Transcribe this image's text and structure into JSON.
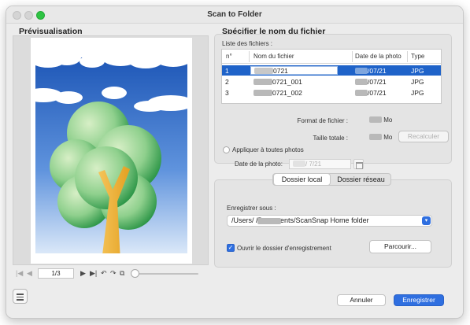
{
  "window": {
    "title": "Scan to Folder"
  },
  "preview": {
    "section_title": "Prévisualisation",
    "page_indicator": "1/3"
  },
  "file_name": {
    "section_title": "Spécifier le nom du fichier",
    "list_label": "Liste des fichiers :",
    "columns": [
      "n°",
      "Nom du fichier",
      "Date de la photo",
      "Type"
    ],
    "rows": [
      {
        "num": "1",
        "name": "0721",
        "date": "/07/21",
        "type": "JPG",
        "selected": true
      },
      {
        "num": "2",
        "name": "0721_001",
        "date": "/07/21",
        "type": "JPG",
        "selected": false
      },
      {
        "num": "3",
        "name": "0721_002",
        "date": "/07/21",
        "type": "JPG",
        "selected": false
      }
    ],
    "format_label": "Format de fichier :",
    "total_size_label": "Taille totale :",
    "size_unit": "Mo",
    "recalc_button": "Recalculer",
    "apply_all_label": "Appliquer à toutes photos",
    "photo_date_label": "Date de la photo:",
    "photo_date_value": "/ 7/21"
  },
  "save": {
    "tabs": [
      "Dossier local",
      "Dossier réseau"
    ],
    "active_tab": "Dossier local",
    "save_under_label": "Enregistrer sous :",
    "path": "/Users/         /Documents/ScanSnap Home folder",
    "open_folder_label": "Ouvrir le dossier d'enregistrement",
    "open_folder_checked": true,
    "browse_button": "Parcourir..."
  },
  "footer": {
    "cancel_button": "Annuler",
    "save_button": "Enregistrer"
  },
  "colors": {
    "accent": "#2f6fe0",
    "selection": "#1f63c9",
    "maximize": "#2ec443"
  }
}
